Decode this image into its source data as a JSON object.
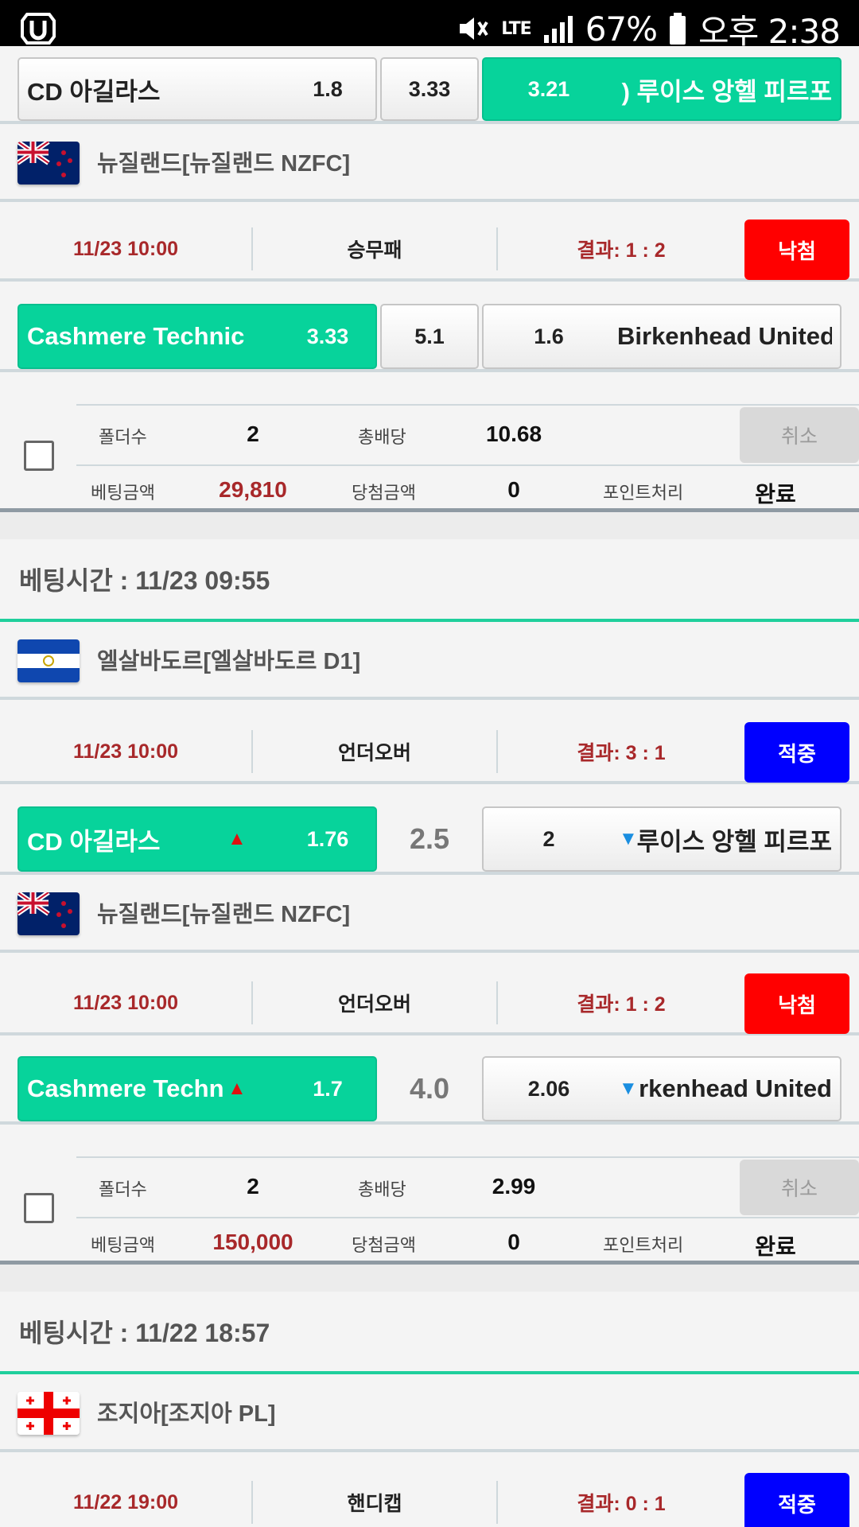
{
  "status_bar": {
    "battery": "67%",
    "network": "LTE",
    "time": "오후 2:38",
    "icons": [
      "app-logo-icon",
      "mute-icon",
      "lte-icon",
      "signal-icon",
      "battery-icon"
    ]
  },
  "colors": {
    "selected": "#07d39b",
    "lose": "#ff0000",
    "win": "#0000ff",
    "date": "#a8282a"
  },
  "top_partial": {
    "home_team": "CD 아길라스",
    "home_odd": "1.8",
    "draw_odd": "3.33",
    "away_odd": "3.21",
    "away_team": ") 루이스 앙헬 피르포"
  },
  "bet1": {
    "match1": {
      "league": "뉴질랜드[뉴질랜드 NZFC]",
      "flag": "new-zealand-flag-icon",
      "datetime": "11/23 10:00",
      "bet_type": "승무패",
      "result": "결과: 1 : 2",
      "status": "낙첨",
      "home_team": "Cashmere Technic",
      "home_odd": "3.33",
      "draw_odd": "5.1",
      "away_odd": "1.6",
      "away_team": "Birkenhead United"
    },
    "summary": {
      "folders_label": "폴더수",
      "folders": "2",
      "total_odds_label": "총배당",
      "total_odds": "10.68",
      "cancel": "취소",
      "bet_amount_label": "베팅금액",
      "bet_amount": "29,810",
      "win_amount_label": "당첨금액",
      "win_amount": "0",
      "points_label": "포인트처리",
      "points": "완료"
    }
  },
  "bet2": {
    "bet_time": "베팅시간 : 11/23 09:55",
    "match1": {
      "league": "엘살바도르[엘살바도르 D1]",
      "flag": "el-salvador-flag-icon",
      "datetime": "11/23 10:00",
      "bet_type": "언더오버",
      "result": "결과: 3 : 1",
      "status": "적중",
      "home_team": "CD 아길라스",
      "home_odd": "1.76",
      "line": "2.5",
      "away_odd": "2",
      "away_team": "루이스 앙헬 피르포"
    },
    "match2": {
      "league": "뉴질랜드[뉴질랜드 NZFC]",
      "flag": "new-zealand-flag-icon",
      "datetime": "11/23 10:00",
      "bet_type": "언더오버",
      "result": "결과: 1 : 2",
      "status": "낙첨",
      "home_team": "Cashmere Techn",
      "home_odd": "1.7",
      "line": "4.0",
      "away_odd": "2.06",
      "away_team": "rkenhead United"
    },
    "summary": {
      "folders_label": "폴더수",
      "folders": "2",
      "total_odds_label": "총배당",
      "total_odds": "2.99",
      "cancel": "취소",
      "bet_amount_label": "베팅금액",
      "bet_amount": "150,000",
      "win_amount_label": "당첨금액",
      "win_amount": "0",
      "points_label": "포인트처리",
      "points": "완료"
    }
  },
  "bet3": {
    "bet_time": "베팅시간 : 11/22 18:57",
    "match1": {
      "league": "조지아[조지아 PL]",
      "flag": "georgia-flag-icon",
      "datetime": "11/22 19:00",
      "bet_type": "핸디캡",
      "result": "결과: 0 : 1",
      "status": "적중"
    }
  }
}
